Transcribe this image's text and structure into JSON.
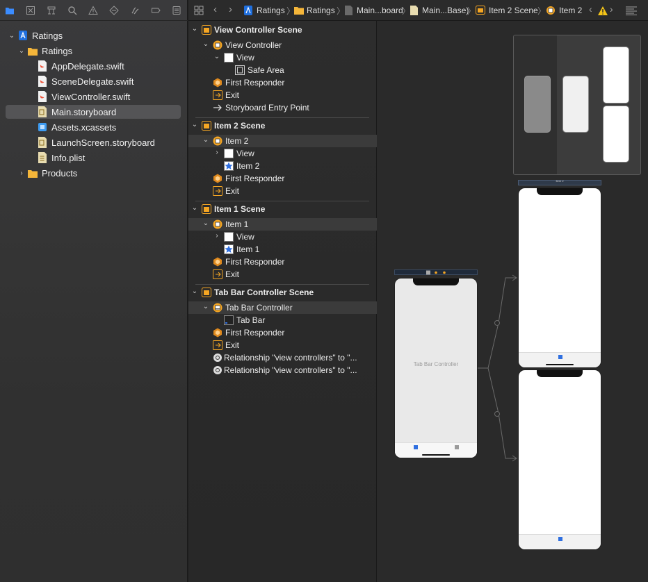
{
  "breadcrumbs": [
    "Ratings",
    "Ratings",
    "Main...board",
    "Main...Base)",
    "Item 2 Scene",
    "Item 2"
  ],
  "navigator": {
    "project": "Ratings",
    "group": "Ratings",
    "files": [
      "AppDelegate.swift",
      "SceneDelegate.swift",
      "ViewController.swift",
      "Main.storyboard",
      "Assets.xcassets",
      "LaunchScreen.storyboard",
      "Info.plist"
    ],
    "products": "Products"
  },
  "outline": {
    "vc_scene": "View Controller Scene",
    "view_controller": "View Controller",
    "view": "View",
    "safe_area": "Safe Area",
    "first_responder": "First Responder",
    "exit": "Exit",
    "entry_point": "Storyboard Entry Point",
    "item2_scene": "Item 2 Scene",
    "item2": "Item 2",
    "item1_scene": "Item 1 Scene",
    "item1": "Item 1",
    "tab_scene": "Tab Bar Controller Scene",
    "tab_controller": "Tab Bar Controller",
    "tab_bar": "Tab Bar",
    "relationship": "Relationship \"view controllers\" to \"..."
  },
  "canvas": {
    "tab_bar_controller_label": "Tab Bar Controller",
    "item2_title": "Item 2"
  },
  "colors": {
    "accent": "#3b8cff",
    "scene_icon": "#f5a623",
    "selected": "#545456"
  }
}
